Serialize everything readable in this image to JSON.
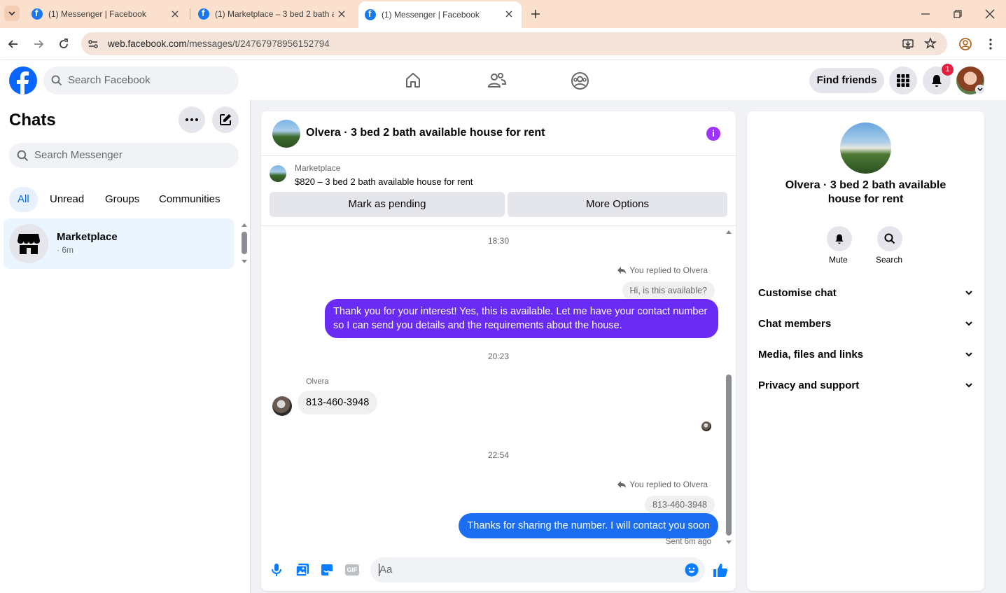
{
  "browser": {
    "tabs": [
      {
        "title": "(1) Messenger | Facebook",
        "active": false
      },
      {
        "title": "(1) Marketplace – 3 bed 2 bath a",
        "active": false
      },
      {
        "title": "(1) Messenger | Facebook",
        "active": true
      }
    ],
    "url_domain": "web.facebook.com",
    "url_path": "/messages/t/24767978956152794"
  },
  "fb_header": {
    "search_placeholder": "Search Facebook",
    "find_friends": "Find friends",
    "notification_count": "1"
  },
  "sidebar": {
    "title": "Chats",
    "search_placeholder": "Search Messenger",
    "filters": [
      "All",
      "Unread",
      "Groups",
      "Communities"
    ],
    "chat_item": {
      "name": "Marketplace",
      "meta": "· 6m"
    }
  },
  "chat": {
    "title": "Olvera · 3 bed 2 bath available house for rent",
    "listing_source": "Marketplace",
    "listing_title": "$820 – 3 bed 2 bath available house for rent",
    "btn_pending": "Mark as pending",
    "btn_more": "More Options",
    "messages": {
      "time1": "18:30",
      "reply_note1": "You replied to Olvera",
      "quoted1": "Hi, is this available?",
      "out1": "Thank you for your interest! Yes, this is available. Let me have your contact number so I can send you details and the requirements about the house.",
      "time2": "20:23",
      "sender": "Olvera",
      "in1": "813-460-3948",
      "time3": "22:54",
      "reply_note2": "You replied to Olvera",
      "quoted2": "813-460-3948",
      "out2": "Thanks for sharing the number. I will contact you soon",
      "status": "Sent 6m ago"
    },
    "composer_placeholder": "Aa",
    "colors": {
      "bubble1": "#6a2cf5",
      "bubble2": "#1b6ef2",
      "accent": "#0a7cff",
      "info_icon": "#a033ff"
    }
  },
  "info": {
    "name": "Olvera · 3 bed 2 bath available house for rent",
    "mute": "Mute",
    "search": "Search",
    "rows": [
      "Customise chat",
      "Chat members",
      "Media, files and links",
      "Privacy and support"
    ]
  }
}
